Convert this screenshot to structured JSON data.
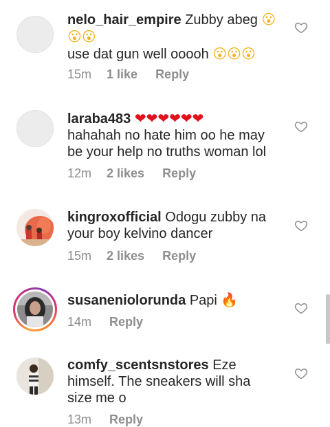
{
  "comments": [
    {
      "username": "nelo_hair_empire",
      "text_lines": [
        "Zubby abeg",
        "use dat gun well ooooh"
      ],
      "emoji_line1": "😮😮😮",
      "emoji_line2": "😮😮😮",
      "time": "15m",
      "likes": "1 like",
      "reply": "Reply"
    },
    {
      "username": "laraba483",
      "hearts": "❤❤❤❤❤❤",
      "text_lines": [
        "hahahah no hate him oo he may",
        "be your help no truths woman lol"
      ],
      "time": "12m",
      "likes": "2 likes",
      "reply": "Reply"
    },
    {
      "username": "kingroxofficial",
      "text_lines": [
        "Odogu zubby na",
        "your boy kelvino dancer"
      ],
      "time": "15m",
      "likes": "2 likes",
      "reply": "Reply"
    },
    {
      "username": "susaneniolorunda",
      "text": "Papi",
      "emoji": "🔥",
      "time": "14m",
      "reply": "Reply"
    },
    {
      "username": "comfy_scentsnstores",
      "text_lines": [
        "Eze",
        "himself. The sneakers will sha",
        "size me o"
      ],
      "time": "13m",
      "reply": "Reply"
    }
  ],
  "icons": {
    "like": "heart-outline-icon",
    "ring_colors": [
      "#f9a23b",
      "#e1306c",
      "#833ab4"
    ]
  }
}
